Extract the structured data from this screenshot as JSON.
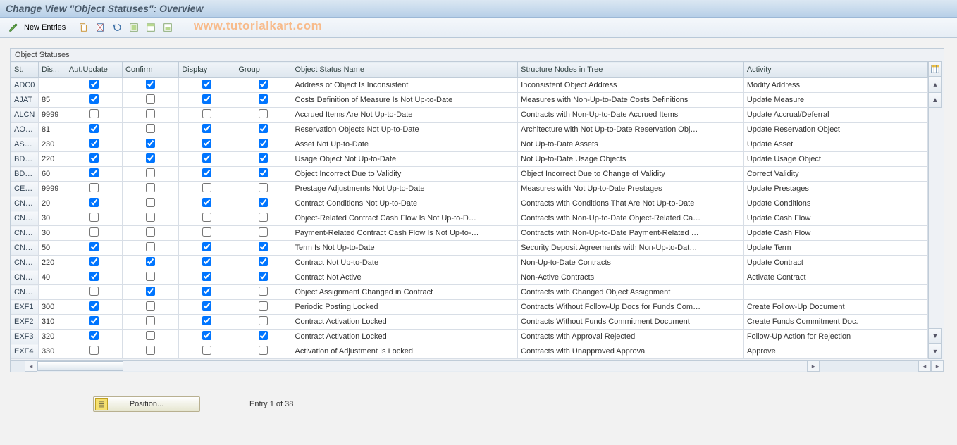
{
  "title": "Change View \"Object Statuses\": Overview",
  "toolbar": {
    "new_entries": "New Entries"
  },
  "watermark": "www.tutorialkart.com",
  "panel_title": "Object Statuses",
  "columns": {
    "st": "St.",
    "dis": "Dis...",
    "upd": "Aut.Update",
    "conf": "Confirm",
    "disp": "Display",
    "grp": "Group",
    "name": "Object Status Name",
    "tree": "Structure Nodes in Tree",
    "act": "Activity"
  },
  "rows": [
    {
      "st": "ADC0",
      "dis": "",
      "upd": true,
      "conf": true,
      "disp": true,
      "grp": true,
      "name": "Address of Object Is Inconsistent",
      "tree": "Inconsistent Object Address",
      "act": "Modify Address"
    },
    {
      "st": "AJAT",
      "dis": "85",
      "upd": true,
      "conf": false,
      "disp": true,
      "grp": true,
      "name": "Costs Definition of Measure Is Not Up-to-Date",
      "tree": "Measures with Non-Up-to-Date Costs Definitions",
      "act": "Update Measure"
    },
    {
      "st": "ALCN",
      "dis": "9999",
      "upd": false,
      "conf": false,
      "disp": false,
      "grp": false,
      "name": "Accrued Items Are Not Up-to-Date",
      "tree": "Contracts with Non-Up-to-Date Accrued Items",
      "act": "Update Accrual/Deferral"
    },
    {
      "st": "AOOO",
      "dis": "81",
      "upd": true,
      "conf": false,
      "disp": true,
      "grp": true,
      "name": "Reservation Objects Not Up-to-Date",
      "tree": "Architecture with Not Up-to-Date Reservation Obj…",
      "act": "Update Reservation Object"
    },
    {
      "st": "ASCH",
      "dis": "230",
      "upd": true,
      "conf": true,
      "disp": true,
      "grp": true,
      "name": "Asset Not Up-to-Date",
      "tree": "Not Up-to-Date Assets",
      "act": "Update Asset"
    },
    {
      "st": "BDCH",
      "dis": "220",
      "upd": true,
      "conf": true,
      "disp": true,
      "grp": true,
      "name": "Usage Object Not Up-to-Date",
      "tree": "Not Up-to-Date Usage Objects",
      "act": "Update Usage Object"
    },
    {
      "st": "BDVP",
      "dis": "60",
      "upd": true,
      "conf": false,
      "disp": true,
      "grp": true,
      "name": "Object Incorrect Due to Validity",
      "tree": "Object Incorrect Due to Change of Validity",
      "act": "Correct Validity"
    },
    {
      "st": "CEAG",
      "dis": "9999",
      "upd": false,
      "conf": false,
      "disp": false,
      "grp": false,
      "name": "Prestage Adjustments Not Up-to-Date",
      "tree": "Measures with Not Up-to-Date Prestages",
      "act": "Update Prestages"
    },
    {
      "st": "CNCD",
      "dis": "20",
      "upd": true,
      "conf": false,
      "disp": true,
      "grp": true,
      "name": "Contract Conditions Not Up-to-Date",
      "tree": "Contracts with Conditions That Are Not Up-to-Date",
      "act": "Update Conditions"
    },
    {
      "st": "CNCO",
      "dis": "30",
      "upd": false,
      "conf": false,
      "disp": false,
      "grp": false,
      "name": "Object-Related Contract Cash Flow Is Not Up-to-D…",
      "tree": "Contracts with Non-Up-to-Date Object-Related Ca…",
      "act": "Update Cash Flow"
    },
    {
      "st": "CNCP",
      "dis": "30",
      "upd": false,
      "conf": false,
      "disp": false,
      "grp": false,
      "name": "Payment-Related Contract Cash Flow Is Not Up-to-…",
      "tree": "Contracts with Non-Up-to-Date Payment-Related …",
      "act": "Update Cash Flow"
    },
    {
      "st": "CNDP",
      "dis": "50",
      "upd": true,
      "conf": false,
      "disp": true,
      "grp": true,
      "name": "Term Is Not Up-to-Date",
      "tree": "Security Deposit Agreements with Non-Up-to-Dat…",
      "act": "Update Term"
    },
    {
      "st": "CNMN",
      "dis": "220",
      "upd": true,
      "conf": true,
      "disp": true,
      "grp": true,
      "name": "Contract Not Up-to-Date",
      "tree": "Non-Up-to-Date Contracts",
      "act": "Update Contract"
    },
    {
      "st": "CNNA",
      "dis": "40",
      "upd": true,
      "conf": false,
      "disp": true,
      "grp": true,
      "name": "Contract Not Active",
      "tree": "Non-Active Contracts",
      "act": "Activate Contract"
    },
    {
      "st": "CNOA",
      "dis": "",
      "upd": false,
      "conf": true,
      "disp": true,
      "grp": false,
      "name": "Object Assignment Changed in Contract",
      "tree": "Contracts with Changed Object Assignment",
      "act": ""
    },
    {
      "st": "EXF1",
      "dis": "300",
      "upd": true,
      "conf": false,
      "disp": true,
      "grp": false,
      "name": "Periodic Posting Locked",
      "tree": "Contracts Without Follow-Up Docs for Funds Com…",
      "act": "Create Follow-Up Document"
    },
    {
      "st": "EXF2",
      "dis": "310",
      "upd": true,
      "conf": false,
      "disp": true,
      "grp": false,
      "name": "Contract Activation Locked",
      "tree": "Contracts Without Funds Commitment Document",
      "act": "Create Funds Commitment Doc."
    },
    {
      "st": "EXF3",
      "dis": "320",
      "upd": true,
      "conf": false,
      "disp": true,
      "grp": true,
      "name": "Contract Activation Locked",
      "tree": "Contracts with Approval Rejected",
      "act": "Follow-Up Action for Rejection"
    },
    {
      "st": "EXF4",
      "dis": "330",
      "upd": false,
      "conf": false,
      "disp": false,
      "grp": false,
      "name": "Activation of Adjustment Is Locked",
      "tree": "Contracts with Unapproved Approval",
      "act": "Approve"
    }
  ],
  "footer": {
    "position_label": "Position...",
    "entry_text": "Entry 1 of 38"
  }
}
